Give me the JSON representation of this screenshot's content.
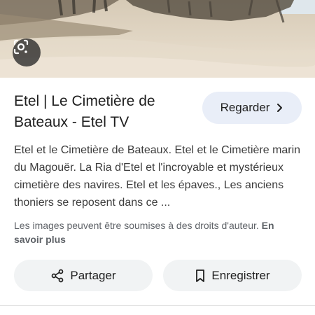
{
  "colors": {
    "accent_button_bg": "#e9eef8",
    "pill_bg": "#f1f3f4",
    "text_primary": "#1f1f1f",
    "text_secondary": "#5f6368"
  },
  "image": {
    "lens_icon": "google-lens-icon"
  },
  "result": {
    "title": "Etel | Le Cimetière de Bateaux - Etel TV",
    "watch_label": "Regarder",
    "watch_icon": "chevron-right-icon",
    "description": "Etel et le Cimetière de Bateaux. Etel et le Cimetière marin du Magouër. La Ria d'Etel et l'incroyable et mystérieux cimetière des navires. Etel et les épaves., Les anciens thoniers se reposent dans ce ...",
    "rights_text": "Les images peuvent être soumises à des droits d'auteur.",
    "learn_more": "En savoir plus"
  },
  "actions": {
    "share_label": "Partager",
    "share_icon": "share-icon",
    "save_label": "Enregistrer",
    "save_icon": "bookmark-icon"
  }
}
